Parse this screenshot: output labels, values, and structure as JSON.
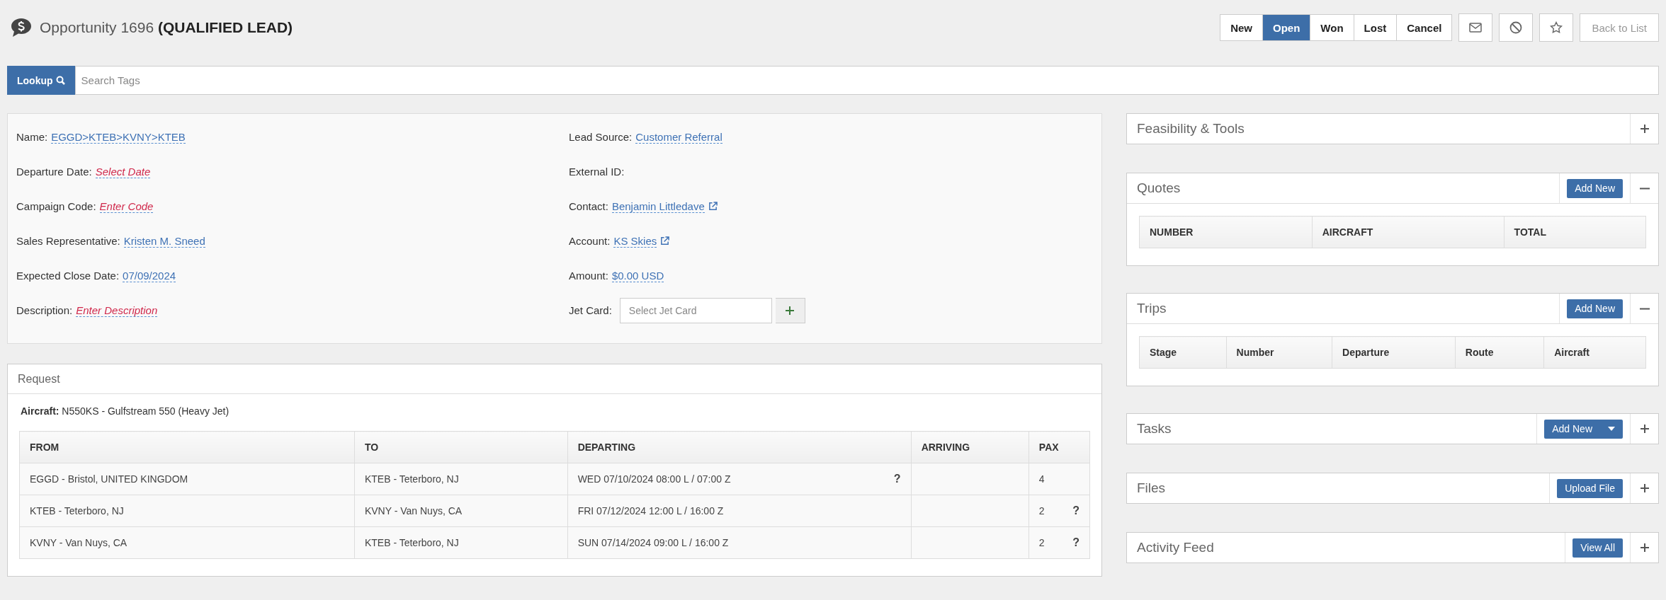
{
  "header": {
    "title": "Opportunity 1696 **(QUALIFIED LEAD)**"
  },
  "status_buttons": [
    {
      "label": "New",
      "selected": false
    },
    {
      "label": "Open",
      "selected": true
    },
    {
      "label": "Won",
      "selected": false
    },
    {
      "label": "Lost",
      "selected": false
    },
    {
      "label": "Cancel",
      "selected": false
    }
  ],
  "back_button": "Back to List",
  "lookup_button": "Lookup",
  "search": {
    "placeholder": "Search Tags"
  },
  "details": {
    "left": [
      {
        "label": "Name:",
        "kind": "value",
        "value": "EGGD>KTEB>KVNY>KTEB"
      },
      {
        "label": "Departure Date:",
        "kind": "empty",
        "value": "Select Date"
      },
      {
        "label": "Campaign Code:",
        "kind": "empty",
        "value": "Enter Code"
      },
      {
        "label": "Sales Representative:",
        "kind": "value",
        "value": "Kristen M. Sneed"
      },
      {
        "label": "Expected Close Date:",
        "kind": "value",
        "value": "07/09/2024"
      },
      {
        "label": "Description:",
        "kind": "empty",
        "value": "Enter Description"
      }
    ],
    "right": [
      {
        "label": "Lead Source:",
        "kind": "value",
        "value": "Customer Referral"
      },
      {
        "label": "External ID:",
        "kind": "none"
      },
      {
        "label": "Contact:",
        "kind": "link",
        "value": "Benjamin Littledave"
      },
      {
        "label": "Account:",
        "kind": "link",
        "value": "KS Skies"
      },
      {
        "label": "Amount:",
        "kind": "value",
        "value": "$0.00 USD"
      },
      {
        "label": "Jet Card:",
        "kind": "select",
        "placeholder": "Select Jet Card"
      }
    ]
  },
  "request": {
    "title": "Request",
    "aircraft": "**Aircraft:** N550KS - Gulfstream 550 (Heavy Jet)",
    "columns": [
      "FROM",
      "TO",
      "DEPARTING",
      "ARRIVING",
      "PAX"
    ],
    "rows": [
      {
        "cells": [
          {
            "text": "EGGD - Bristol, UNITED KINGDOM"
          },
          {
            "text": "KTEB - Teterboro, NJ"
          },
          {
            "text": "WED 07/10/2024 08:00 L / 07:00 Z",
            "note": "?"
          },
          {},
          {
            "text": "4"
          }
        ]
      },
      {
        "cells": [
          {
            "text": "KTEB - Teterboro, NJ"
          },
          {
            "text": "KVNY - Van Nuys, CA"
          },
          {
            "text": "FRI 07/12/2024 12:00 L / 16:00 Z"
          },
          {},
          {
            "text": "2",
            "note": "?"
          }
        ]
      },
      {
        "cells": [
          {
            "text": "KVNY - Van Nuys, CA"
          },
          {
            "text": "KTEB - Teterboro, NJ"
          },
          {
            "text": "SUN 07/14/2024 09:00 L / 16:00 Z"
          },
          {},
          {
            "text": "2",
            "note": "?"
          }
        ]
      }
    ]
  },
  "panels": [
    {
      "title": "Feasibility & Tools",
      "expanded": false
    },
    {
      "title": "Quotes",
      "expanded": true,
      "action": {
        "label": "Add New",
        "dropdown": false
      },
      "columns": [
        "NUMBER",
        "AIRCRAFT",
        "TOTAL"
      ]
    },
    {
      "title": "Trips",
      "expanded": true,
      "action": {
        "label": "Add New",
        "dropdown": false
      },
      "columns": [
        "Stage",
        "Number",
        "Departure",
        "Route",
        "Aircraft"
      ]
    },
    {
      "title": "Tasks",
      "expanded": false,
      "action": {
        "label": "Add New",
        "dropdown": true
      }
    },
    {
      "title": "Files",
      "expanded": false,
      "action": {
        "label": "Upload File",
        "dropdown": false
      }
    },
    {
      "title": "Activity Feed",
      "expanded": false,
      "action": {
        "label": "View All",
        "dropdown": false
      }
    }
  ]
}
